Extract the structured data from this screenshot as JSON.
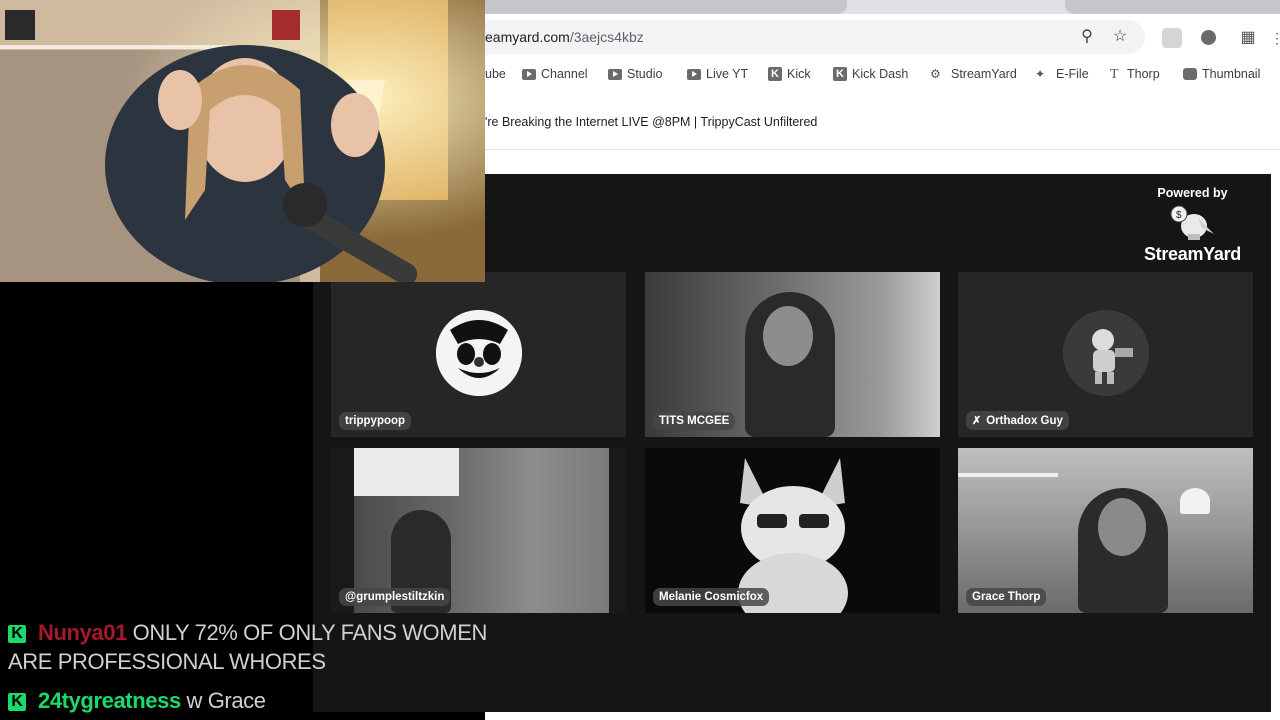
{
  "browser": {
    "url_prefix": "",
    "url_host": "eamyard.com",
    "url_path": "/3aejcs4kbz",
    "bookmarks": [
      {
        "label": "ube",
        "icon": "youtube-icon"
      },
      {
        "label": "Channel",
        "icon": "youtube-icon"
      },
      {
        "label": "Studio",
        "icon": "youtube-icon"
      },
      {
        "label": "Live YT",
        "icon": "youtube-icon"
      },
      {
        "label": "Kick",
        "icon": "kick-icon"
      },
      {
        "label": "Kick Dash",
        "icon": "kick-icon"
      },
      {
        "label": "StreamYard",
        "icon": "streamyard-icon"
      },
      {
        "label": "E-File",
        "icon": "efile-icon"
      },
      {
        "label": "Thorp",
        "icon": "thorp-icon"
      },
      {
        "label": "Thumbnail",
        "icon": "thumbnail-icon"
      }
    ],
    "page_title": "'re Breaking the Internet LIVE @8PM | TrippyCast Unfiltered"
  },
  "stage": {
    "powered_by": "Powered by",
    "brand": "StreamYard",
    "participants": [
      {
        "name": "trippypoop",
        "muted": false
      },
      {
        "name": "TITS MCGEE",
        "muted": false
      },
      {
        "name": "Orthadox Guy",
        "muted": true
      },
      {
        "name": "@grumplestiltzkin",
        "muted": false
      },
      {
        "name": "Melanie Cosmicfox",
        "muted": false
      },
      {
        "name": "Grace Thorp",
        "muted": false
      }
    ]
  },
  "chat": {
    "messages": [
      {
        "user": "Nunya01",
        "text": "ONLY 72% OF ONLY FANS WOMEN",
        "text_cont": "ARE PROFESSIONAL WHORES",
        "badge": "K",
        "user_color": "#a4192b"
      },
      {
        "user": "24tygreatness",
        "text": "w Grace",
        "badge": "K",
        "user_color": "#1bd96a"
      }
    ]
  },
  "colors": {
    "kick_green": "#1bd96a",
    "stage_bg": "#151515",
    "tile_bg": "#262626"
  }
}
